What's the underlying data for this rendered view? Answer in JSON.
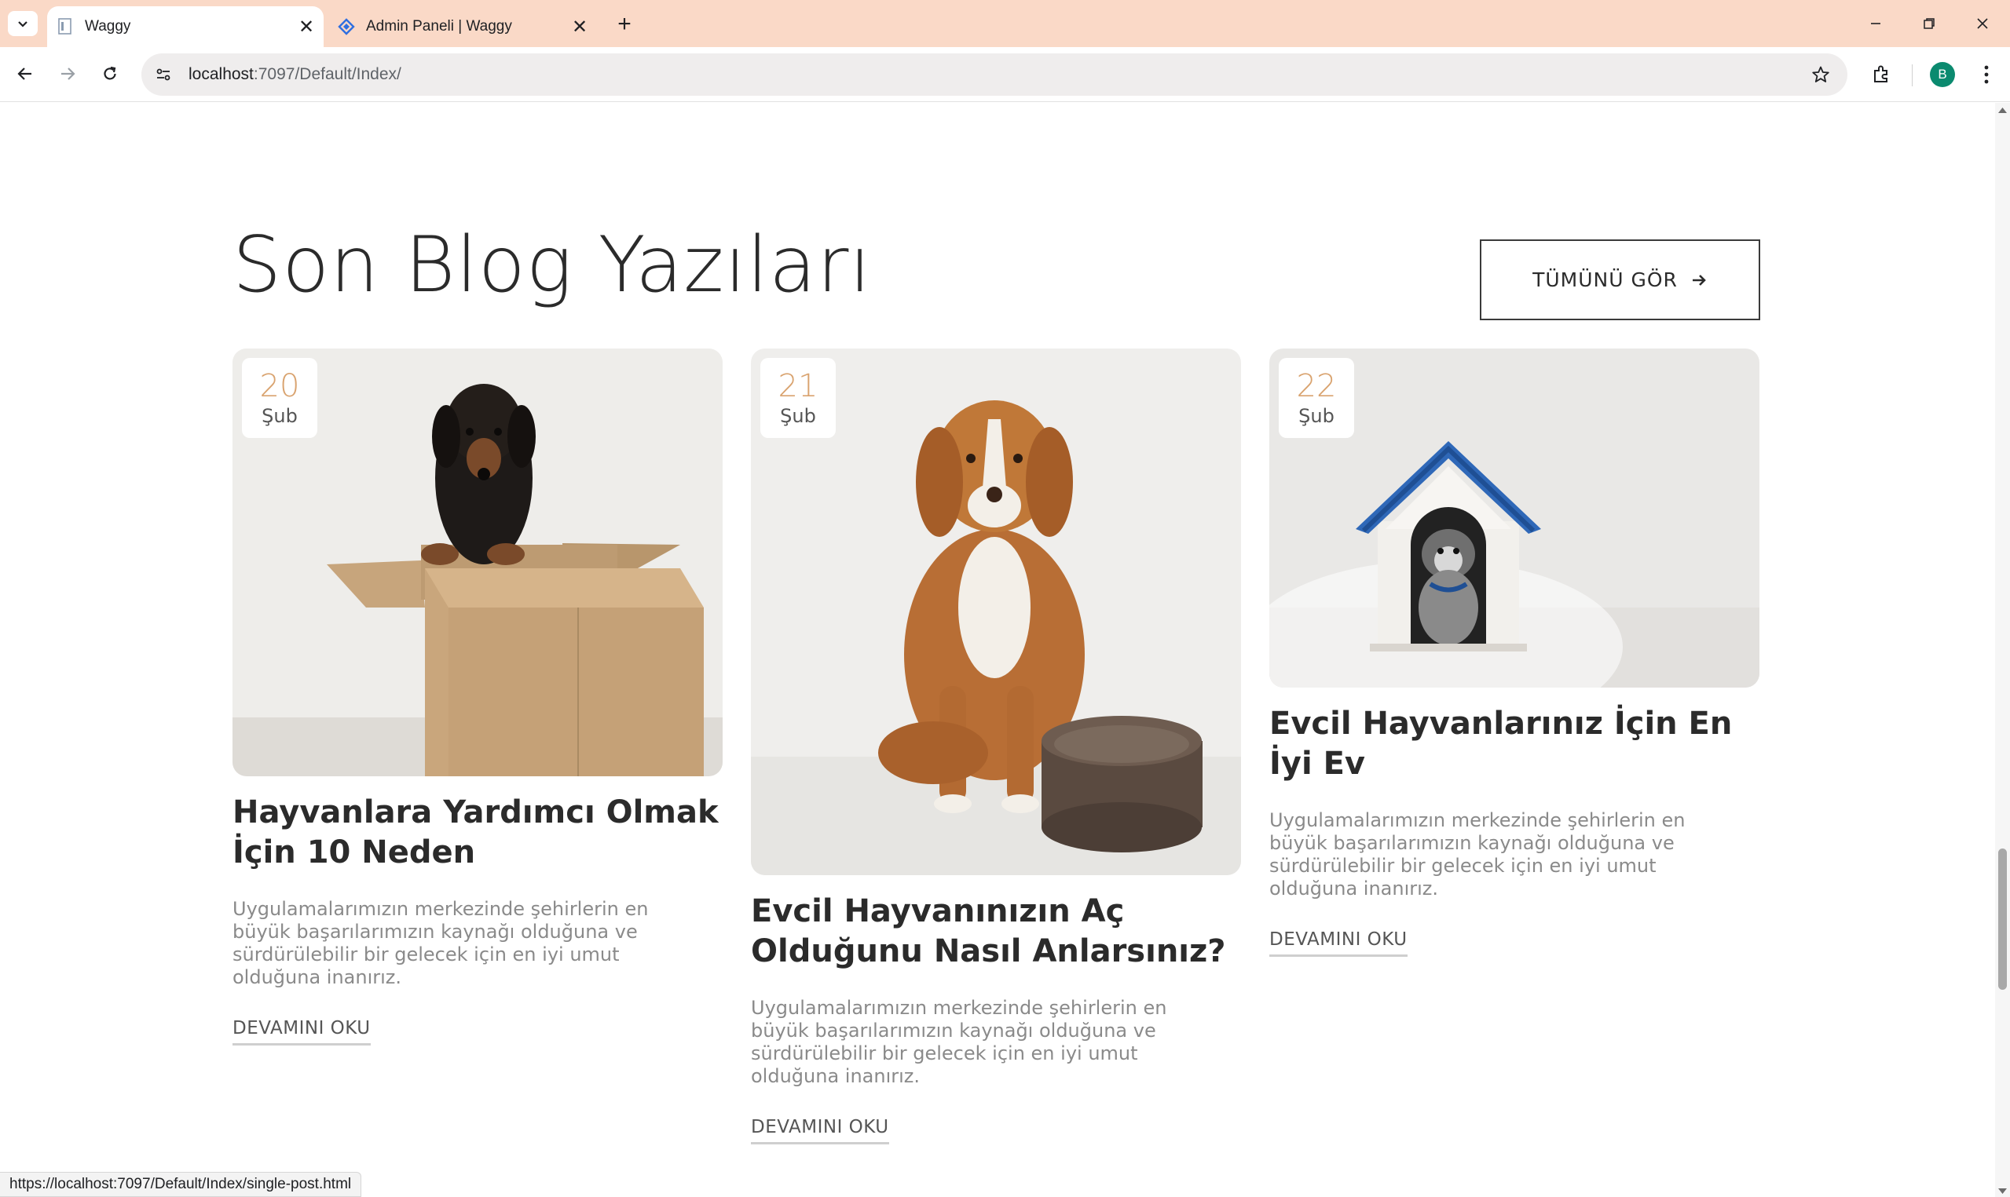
{
  "browser": {
    "tabs": [
      {
        "title": "Waggy",
        "favicon": "document-favicon-icon",
        "active": true
      },
      {
        "title": "Admin Paneli | Waggy",
        "favicon": "diamond-favicon-icon",
        "active": false
      }
    ],
    "url_host": "localhost",
    "url_rest": ":7097/Default/Index/",
    "profile_initial": "B",
    "status_url": "https://localhost:7097/Default/Index/single-post.html"
  },
  "section": {
    "title": "Son Blog Yazıları",
    "see_all_label": "TÜMÜNÜ GÖR"
  },
  "posts": [
    {
      "day": "20",
      "month": "Şub",
      "title": "Hayvanlara Yardımcı Olmak İçin 10 Neden",
      "excerpt": "Uygulamalarımızın merkezinde şehirlerin en büyük başarılarımızın kaynağı olduğuna ve sürdürülebilir bir gelecek için en iyi umut olduğuna inanırız.",
      "read_more": "DEVAMINI OKU",
      "image": "dachshund-in-cardboard-box"
    },
    {
      "day": "21",
      "month": "Şub",
      "title": "Evcil Hayvanınızın Aç Olduğunu Nasıl Anlarsınız?",
      "excerpt": "Uygulamalarımızın merkezinde şehirlerin en büyük başarılarımızın kaynağı olduğuna ve sürdürülebilir bir gelecek için en iyi umut olduğuna inanırız.",
      "read_more": "DEVAMINI OKU",
      "image": "dog-with-food-bowl"
    },
    {
      "day": "22",
      "month": "Şub",
      "title": "Evcil Hayvanlarınız İçin En İyi Ev",
      "excerpt": "Uygulamalarımızın merkezinde şehirlerin en büyük başarılarımızın kaynağı olduğuna ve sürdürülebilir bir gelecek için en iyi umut olduğuna inanırız.",
      "read_more": "DEVAMINI OKU",
      "image": "dog-in-kennel"
    }
  ],
  "colors": {
    "tab_strip": "#fad9c7",
    "date_accent": "#d9a36f",
    "heading": "#2b2b2b",
    "excerpt": "#8a8a8a"
  }
}
